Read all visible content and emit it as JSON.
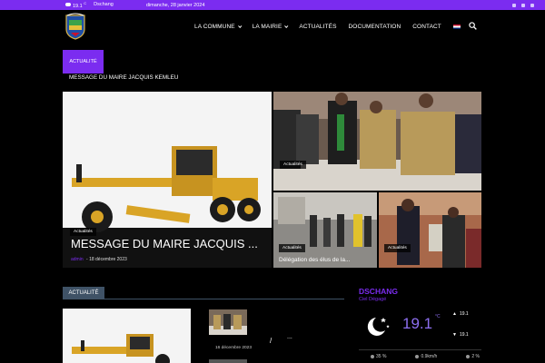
{
  "topbar": {
    "temp": "19.1",
    "temp_unit": "C",
    "city": "Dschang",
    "date": "dimanche, 28 janvier 2024"
  },
  "nav": {
    "items": [
      {
        "label": "LA COMMUNE",
        "dropdown": true
      },
      {
        "label": "LA MAIRIE",
        "dropdown": true
      },
      {
        "label": "ACTUALITÉS",
        "dropdown": false
      },
      {
        "label": "DOCUMENTATION",
        "dropdown": false
      },
      {
        "label": "CONTACT",
        "dropdown": false
      }
    ]
  },
  "breaking": {
    "badge": "Actualité",
    "headline": "MESSAGE DU MAIRE JACQUIS KEMLEU"
  },
  "grid": {
    "big": {
      "category": "Actualités",
      "title": "MESSAGE DU MAIRE JACQUIS ...",
      "author": "admin",
      "date": "18 décembre 2023"
    },
    "tile1": {
      "category": "Actualités"
    },
    "tile2": {
      "category": "Actualités",
      "title": "Délégation des élus de la..."
    },
    "tile3": {
      "category": "Actualités"
    }
  },
  "section": {
    "label": "Actualité",
    "date": "16 décembre 2023",
    "slash": "/",
    "ellipsis": "..."
  },
  "weather": {
    "city": "DSCHANG",
    "desc": "Ciel Dégagé",
    "temp": "19.1",
    "unit": "°C",
    "high": "19.1",
    "low": "19.1",
    "humidity": "35 %",
    "wind": "0.9km/h",
    "clouds": "2 %"
  },
  "colors": {
    "accent": "#7b2cf0",
    "section_badge": "#3f5266",
    "background": "#000000"
  }
}
